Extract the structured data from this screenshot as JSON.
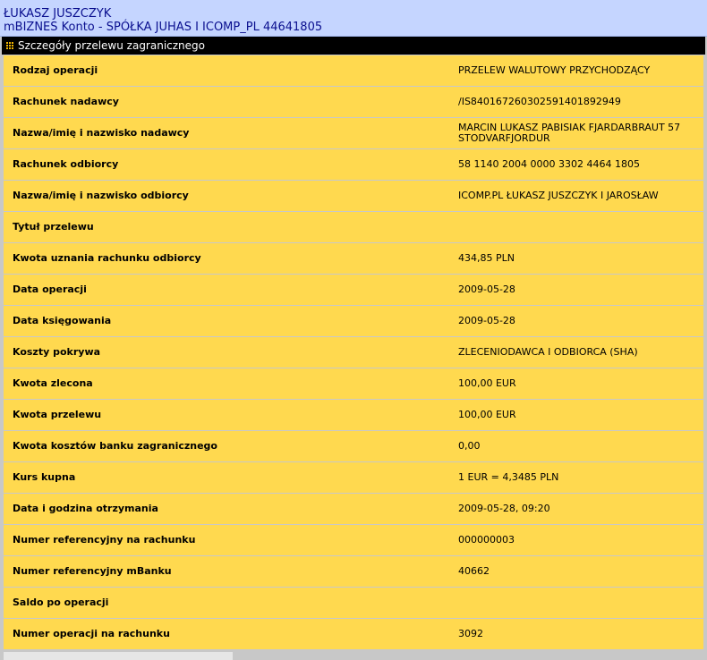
{
  "header": {
    "user_name": "ŁUKASZ JUSZCZYK",
    "account_name": "mBIZNES Konto - SPÓŁKA JUHAS I ICOMP_PL 44641805"
  },
  "section": {
    "title": "Szczegóły przelewu zagranicznego",
    "icon": "grid-icon",
    "accent_color": "#f0b400"
  },
  "colors": {
    "header_bg": "#c5d5ff",
    "header_text": "#0a0f8f",
    "row_bg": "#ffd94f",
    "divider": "#c8c8c8",
    "section_bar": "#000000"
  },
  "rows": [
    {
      "label": "Rodzaj operacji",
      "value": "PRZELEW WALUTOWY PRZYCHODZĄCY"
    },
    {
      "label": "Rachunek nadawcy",
      "value": "/IS840167260302591401892949"
    },
    {
      "label": "Nazwa/imię i nazwisko nadawcy",
      "value": "MARCIN LUKASZ PABISIAK FJARDARBRAUT 57 STODVARFJORDUR"
    },
    {
      "label": "Rachunek odbiorcy",
      "value": "58 1140 2004 0000 3302 4464 1805"
    },
    {
      "label": "Nazwa/imię i nazwisko odbiorcy",
      "value": "ICOMP.PL ŁUKASZ JUSZCZYK I JAROSŁAW"
    },
    {
      "label": "Tytuł przelewu",
      "value": ""
    },
    {
      "label": "Kwota uznania rachunku odbiorcy",
      "value": "434,85 PLN"
    },
    {
      "label": "Data operacji",
      "value": "2009-05-28"
    },
    {
      "label": "Data księgowania",
      "value": "2009-05-28"
    },
    {
      "label": "Koszty pokrywa",
      "value": "ZLECENIODAWCA I ODBIORCA (SHA)"
    },
    {
      "label": "Kwota zlecona",
      "value": "100,00 EUR"
    },
    {
      "label": "Kwota przelewu",
      "value": "100,00 EUR"
    },
    {
      "label": "Kwota kosztów banku zagranicznego",
      "value": "0,00"
    },
    {
      "label": "Kurs kupna",
      "value": "1 EUR = 4,3485 PLN"
    },
    {
      "label": "Data i godzina otrzymania",
      "value": "2009-05-28, 09:20"
    },
    {
      "label": "Numer referencyjny na rachunku",
      "value": "000000003"
    },
    {
      "label": "Numer referencyjny mBanku",
      "value": "40662"
    },
    {
      "label": "Saldo po operacji",
      "value": ""
    },
    {
      "label": "Numer operacji na rachunku",
      "value": "3092"
    }
  ]
}
